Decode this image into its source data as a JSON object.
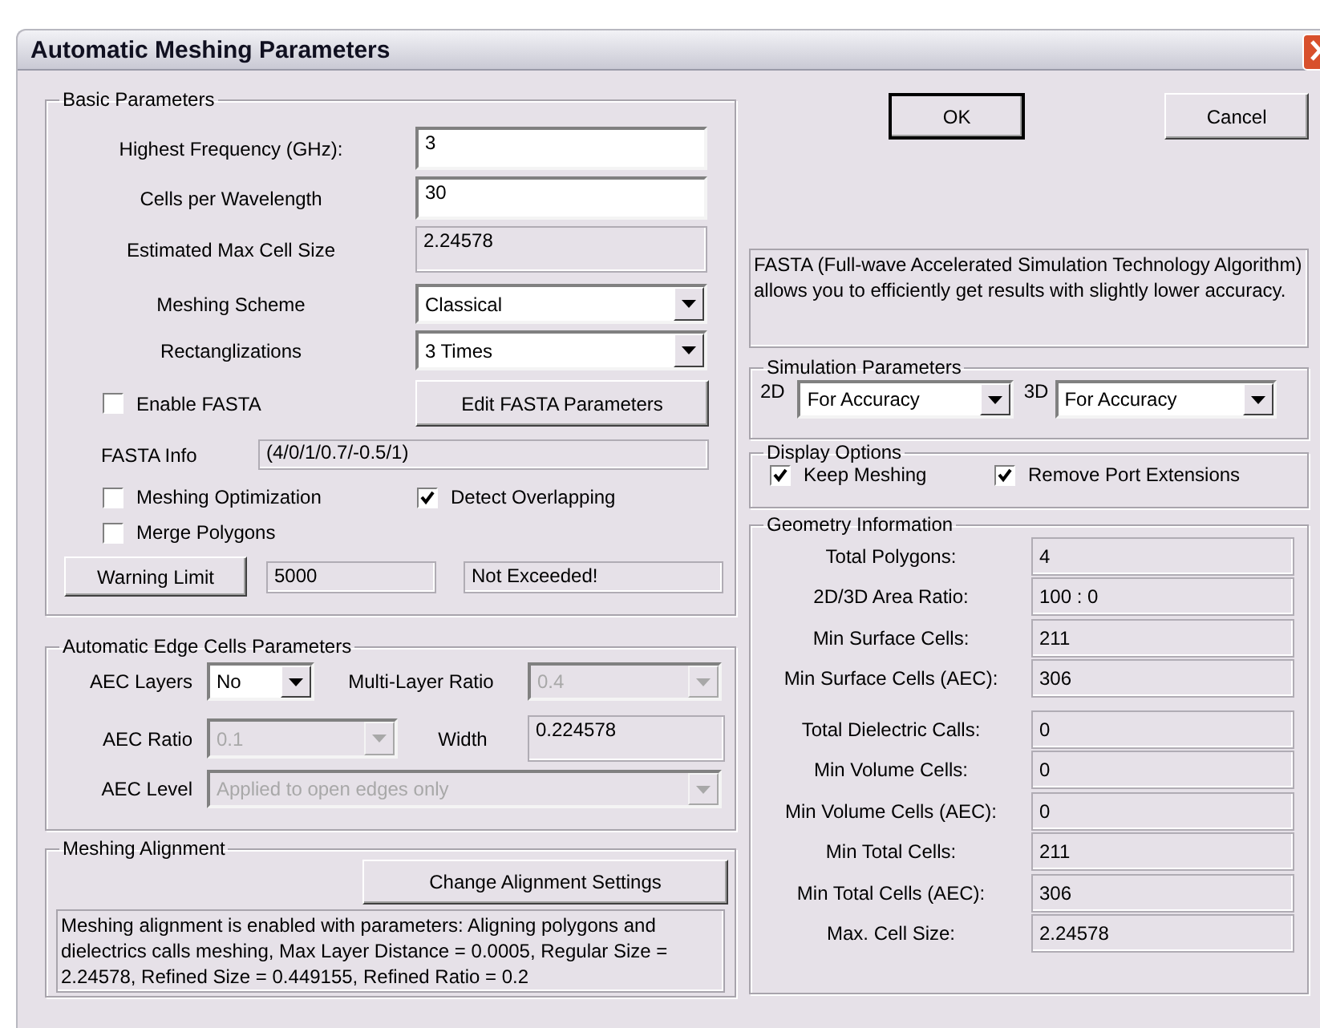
{
  "window": {
    "title": "Automatic Meshing Parameters"
  },
  "basic_parameters": {
    "title": "Basic Parameters",
    "fields": [
      {
        "label": "Highest Frequency (GHz):",
        "kind": "input",
        "value": "3"
      },
      {
        "label": "Cells per Wavelength",
        "kind": "input",
        "value": "30"
      },
      {
        "label": "Estimated Max Cell Size",
        "kind": "readonly",
        "value": "2.24578"
      },
      {
        "label": "Meshing Scheme",
        "kind": "dropdown",
        "value": "Classical"
      },
      {
        "label": "Rectanglizations",
        "kind": "dropdown",
        "value": "3 Times"
      }
    ],
    "enable_fasta": {
      "label": "Enable FASTA",
      "checked": false
    },
    "edit_fasta_button": "Edit FASTA Parameters",
    "fasta_info": {
      "label": "FASTA Info",
      "value": "(4/0/1/0.7/-0.5/1)"
    },
    "options": [
      {
        "label": "Meshing Optimization",
        "checked": false
      },
      {
        "label": "Detect Overlapping",
        "checked": true
      },
      {
        "label": "Merge Polygons",
        "checked": false
      }
    ],
    "warning_limit": {
      "button": "Warning Limit",
      "value": "5000",
      "status": "Not Exceeded!"
    }
  },
  "aec_parameters": {
    "title": "Automatic Edge Cells Parameters",
    "aec_layers": {
      "label": "AEC Layers",
      "value": "No",
      "disabled": false
    },
    "multi_layer_ratio": {
      "label": "Multi-Layer Ratio",
      "value": "0.4",
      "disabled": true
    },
    "aec_ratio": {
      "label": "AEC Ratio",
      "value": "0.1",
      "disabled": true
    },
    "width": {
      "label": "Width",
      "value": "0.224578"
    },
    "aec_level": {
      "label": "AEC Level",
      "value": "Applied to open edges only",
      "disabled": true
    }
  },
  "meshing_alignment": {
    "title": "Meshing Alignment",
    "button": "Change Alignment Settings",
    "description": "Meshing alignment is enabled with parameters: Aligning polygons and dielectrics calls meshing, Max Layer Distance = 0.0005, Regular Size = 2.24578, Refined Size = 0.449155, Refined Ratio = 0.2"
  },
  "buttons": [
    {
      "label": "OK",
      "default": true
    },
    {
      "label": "Cancel",
      "default": false
    }
  ],
  "fasta_description": "FASTA (Full-wave Accelerated Simulation Technology Algorithm) allows you to efficiently get results with slightly lower accuracy.",
  "simulation_parameters": {
    "title": "Simulation Parameters",
    "modes": [
      {
        "label": "2D",
        "value": "For Accuracy"
      },
      {
        "label": "3D",
        "value": "For Accuracy"
      }
    ]
  },
  "display_options": {
    "title": "Display Options",
    "options": [
      {
        "label": "Keep Meshing",
        "checked": true
      },
      {
        "label": "Remove Port Extensions",
        "checked": true
      }
    ]
  },
  "geometry_information": {
    "title": "Geometry Information",
    "sections": [
      {
        "rows": [
          {
            "label": "Total Polygons:",
            "value": "4"
          },
          {
            "label": "2D/3D Area Ratio:",
            "value": "100 : 0"
          },
          {
            "label": "Min Surface Cells:",
            "value": "211"
          },
          {
            "label": "Min Surface Cells (AEC):",
            "value": "306"
          }
        ]
      },
      {
        "rows": [
          {
            "label": "Total Dielectric Calls:",
            "value": "0"
          },
          {
            "label": "Min Volume Cells:",
            "value": "0"
          },
          {
            "label": "Min Volume Cells (AEC):",
            "value": "0"
          },
          {
            "label": "Min Total Cells:",
            "value": "211"
          },
          {
            "label": "Min Total Cells (AEC):",
            "value": "306"
          },
          {
            "label": "Max. Cell Size:",
            "value": "2.24578"
          }
        ]
      }
    ]
  }
}
